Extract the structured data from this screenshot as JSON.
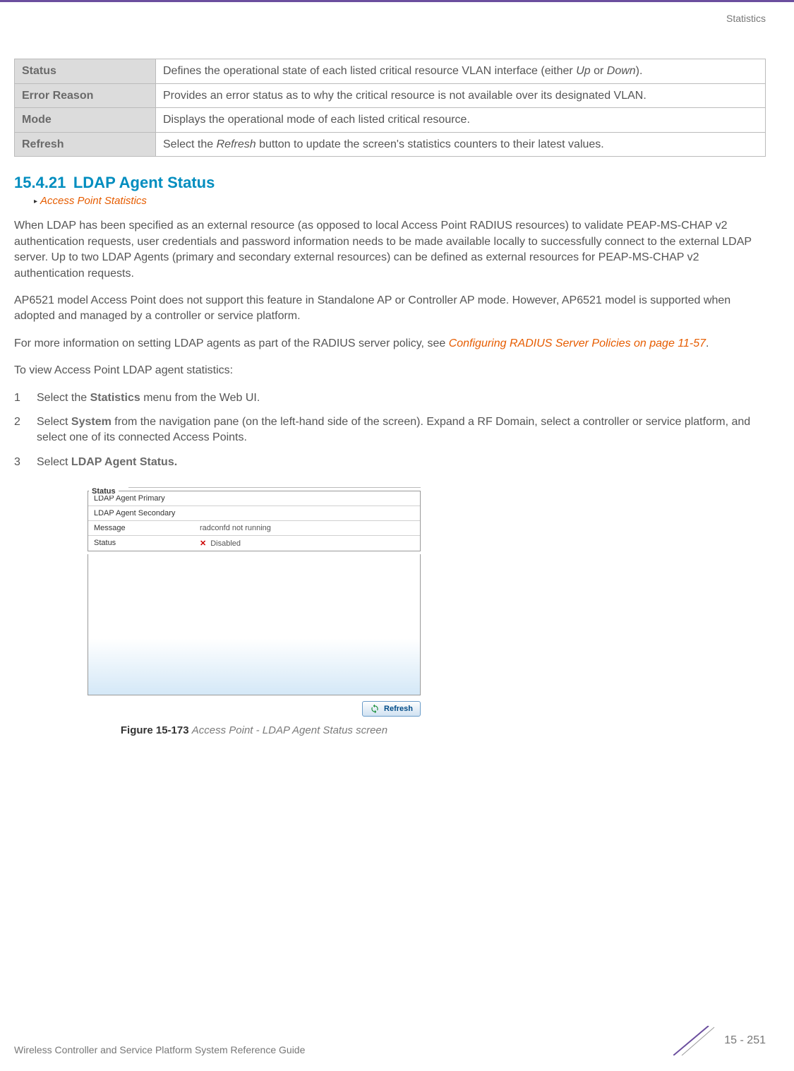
{
  "header": {
    "section_label": "Statistics"
  },
  "def_table": [
    {
      "label": "Status",
      "text_before": "Defines the operational state of each listed critical resource VLAN interface (either ",
      "italic1": "Up",
      "mid": " or ",
      "italic2": "Down",
      "text_after": ")."
    },
    {
      "label": "Error Reason",
      "text": "Provides an error status as to why the critical resource is not available over its designated VLAN."
    },
    {
      "label": "Mode",
      "text": "Displays the operational mode of each listed critical resource."
    },
    {
      "label": "Refresh",
      "text_before": "Select the ",
      "italic1": "Refresh",
      "text_after": " button to update the screen's statistics counters to their latest values."
    }
  ],
  "section": {
    "number": "15.4.21",
    "title": "LDAP Agent Status",
    "breadcrumb": "Access Point Statistics"
  },
  "paragraphs": {
    "p1": "When LDAP has been specified as an external resource (as opposed to local Access Point RADIUS resources) to validate PEAP-MS-CHAP v2 authentication requests, user credentials and password information needs to be made available locally to successfully connect to the external LDAP server. Up to two LDAP Agents (primary and secondary external resources) can be defined as external resources for PEAP-MS-CHAP v2 authentication requests.",
    "p2": "AP6521 model Access Point does not support this feature in Standalone AP or Controller AP mode. However, AP6521 model is supported when adopted and managed by a controller or service platform.",
    "p3_before": "For more information on setting LDAP agents as part of the RADIUS server policy, see ",
    "p3_link": "Configuring RADIUS Server Policies on page 11-57",
    "p3_after": ".",
    "p4": "To view Access Point LDAP agent statistics:"
  },
  "steps": [
    {
      "num": "1",
      "before": "Select the ",
      "bold": "Statistics",
      "after": " menu from the Web UI."
    },
    {
      "num": "2",
      "before": "Select ",
      "bold": "System",
      "after": " from the navigation pane (on the left-hand side of the screen). Expand a RF Domain, select a controller or service platform, and select one of its connected Access Points."
    },
    {
      "num": "3",
      "before": "Select ",
      "bold": "LDAP Agent Status.",
      "after": ""
    }
  ],
  "status_panel": {
    "legend": "Status",
    "rows": [
      {
        "key": "LDAP Agent Primary",
        "val": ""
      },
      {
        "key": "LDAP Agent Secondary",
        "val": ""
      },
      {
        "key": "Message",
        "val": "radconfd not running"
      },
      {
        "key": "Status",
        "val": "Disabled",
        "icon": "x"
      }
    ],
    "refresh_label": "Refresh"
  },
  "figure": {
    "label": "Figure 15-173",
    "desc": "Access Point - LDAP Agent Status screen"
  },
  "footer": {
    "guide": "Wireless Controller and Service Platform System Reference Guide",
    "page": "15 - 251"
  }
}
